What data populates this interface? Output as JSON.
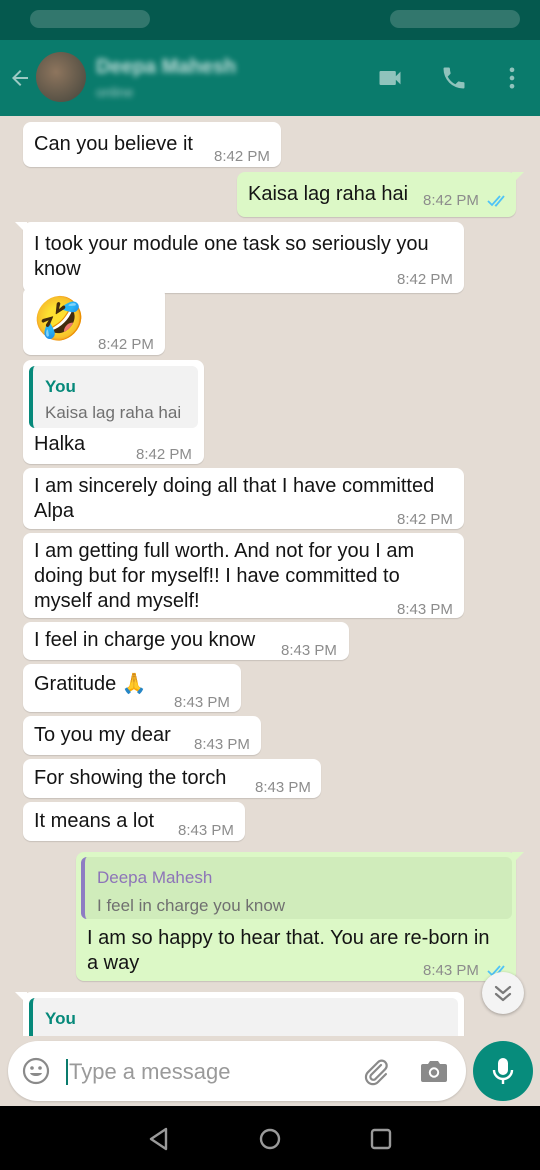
{
  "header": {
    "contact_name": "Deepa Mahesh",
    "contact_status": "online"
  },
  "messages": {
    "m1": {
      "text": "Can you believe it",
      "time": "8:42 PM"
    },
    "m2": {
      "text": "Kaisa lag raha hai",
      "time": "8:42 PM"
    },
    "m3": {
      "line1": "I took your module one task so seriously you",
      "line2": "know",
      "time": "8:42 PM"
    },
    "m4": {
      "emoji": "🤣",
      "time": "8:42 PM"
    },
    "m5": {
      "quote_name": "You",
      "quote_text": "Kaisa lag raha hai",
      "text": "Halka",
      "time": "8:42 PM"
    },
    "m6": {
      "line1": "I am sincerely doing all that I have committed",
      "line2": "Alpa",
      "time": "8:42 PM"
    },
    "m7": {
      "line1": "I am getting full worth. And not for you I am",
      "line2": "doing but for myself!! I have committed to",
      "line3": "myself and myself!",
      "time": "8:43 PM"
    },
    "m8": {
      "text": "I feel in charge you know",
      "time": "8:43 PM"
    },
    "m9": {
      "text": "Gratitude 🙏",
      "time": "8:43 PM"
    },
    "m10": {
      "text": "To you my dear",
      "time": "8:43 PM"
    },
    "m11": {
      "text": "For showing the torch",
      "time": "8:43 PM"
    },
    "m12": {
      "text": "It means a lot",
      "time": "8:43 PM"
    },
    "m13": {
      "quote_name": "Deepa Mahesh",
      "quote_text": "I feel in charge you know",
      "line1": "I am so happy to hear that. You are re-born in",
      "line2": "a way",
      "time": "8:43 PM"
    },
    "m14": {
      "quote_name": "You"
    }
  },
  "input": {
    "placeholder": "Type a message"
  },
  "icons": {
    "back": "arrow-back-icon",
    "video": "video-call-icon",
    "call": "phone-icon",
    "menu": "more-vert-icon",
    "emoji": "emoji-icon",
    "attach": "paperclip-icon",
    "camera": "camera-icon",
    "mic": "mic-icon",
    "scroll": "double-chevron-down-icon",
    "nav_back": "nav-back-icon",
    "nav_home": "nav-home-icon",
    "nav_recents": "nav-recents-icon"
  },
  "colors": {
    "header": "#0a7b6c",
    "outgoing_bubble": "#dcf8c6",
    "incoming_bubble": "#ffffff",
    "chat_background": "#e4dcd4",
    "read_ticks": "#4fc3f7"
  }
}
